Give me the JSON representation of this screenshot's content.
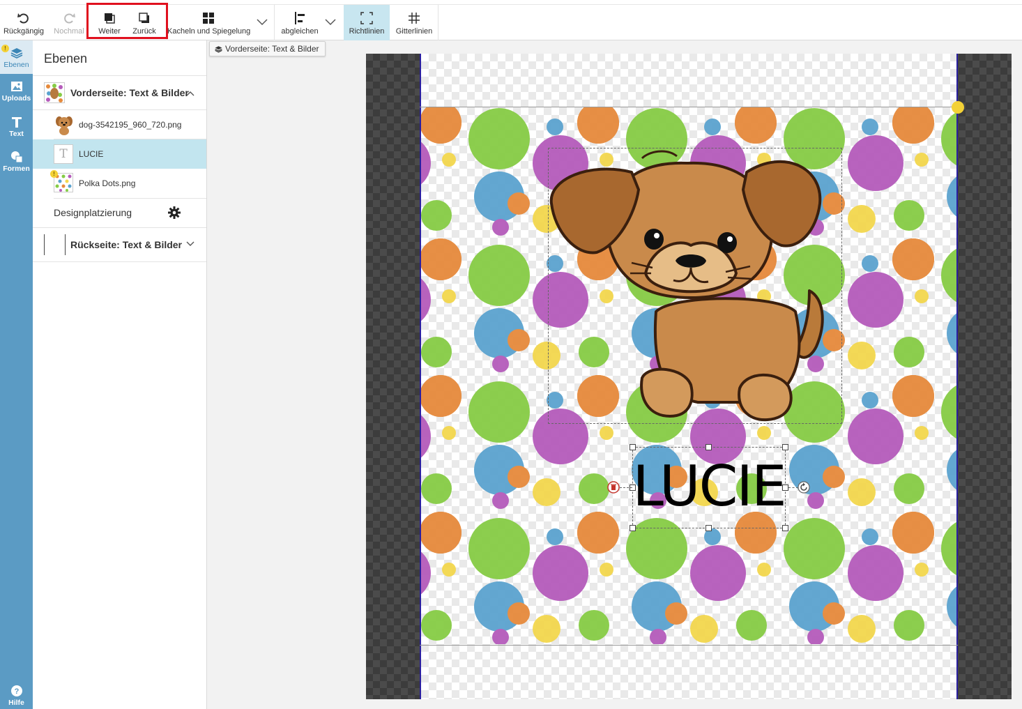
{
  "toolbar": {
    "undo_label": "Rückgängig",
    "redo_label": "Nochmal",
    "forward_label": "Weiter",
    "backward_label": "Zurück",
    "tiles_label": "Kacheln und Spiegelung",
    "align_label": "abgleichen",
    "guides_label": "Richtlinien",
    "grid_label": "Gitterlinien"
  },
  "rail": {
    "layers_label": "Ebenen",
    "uploads_label": "Uploads",
    "text_label": "Text",
    "shapes_label": "Formen",
    "help_label": "Hilfe"
  },
  "panel": {
    "title": "Ebenen",
    "front_group": "Vorderseite: Text & Bilder",
    "layers": [
      {
        "name": "dog-3542195_960_720.png"
      },
      {
        "name": "LUCIE"
      },
      {
        "name": "Polka Dots.png"
      }
    ],
    "design_placement": "Designplatzierung",
    "back_group": "Rückseite: Text & Bilder"
  },
  "workspace": {
    "breadcrumb": "Vorderseite: Text & Bilder",
    "text_object": "LUCIE"
  },
  "colors": {
    "rail_bg": "#5b9bc4",
    "selected_layer": "#c2e5ef",
    "active_tool": "#c8e6f0",
    "highlight_red": "#e0101e",
    "dot_orange": "#e68a3c",
    "dot_green": "#86cc45",
    "dot_purple": "#b55bbb",
    "dot_blue": "#5ba3cf",
    "dot_yellow": "#f3d74e"
  }
}
